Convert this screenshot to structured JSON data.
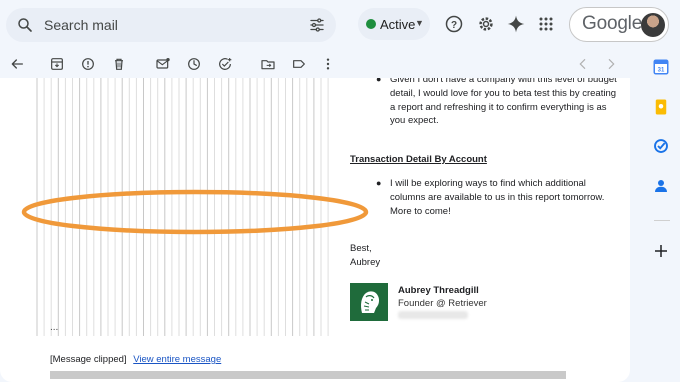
{
  "topbar": {
    "search_placeholder": "Search mail",
    "status_label": "Active",
    "brand_label": "Google"
  },
  "email": {
    "bullet1": "Given I don't have a company with this level of budget detail, I would love for you to beta test this by creating a report and refreshing it to confirm everything is as you expect.",
    "heading": "Transaction Detail By Account",
    "bullet2": "I will be exploring ways to find which additional columns are available to us in this report tomorrow. More to come!",
    "closing": "Best,",
    "sender": "Aubrey",
    "signature_name": "Aubrey Threadgill",
    "signature_role": "Founder @ Retriever",
    "ellipsis": "...",
    "clipped_notice": "[Message clipped]",
    "view_link": "View entire message"
  },
  "colors": {
    "active_dot": "#1e8e3e",
    "annotation_oval": "#f0993a",
    "signature_logo_bg": "#1f6b3b",
    "link": "#1a55c4"
  },
  "icons": [
    "search-icon",
    "tune-icon",
    "help-icon",
    "settings-icon",
    "gemini-icon",
    "apps-icon",
    "back-icon",
    "archive-icon",
    "report-spam-icon",
    "delete-icon",
    "mark-unread-icon",
    "snooze-icon",
    "add-task-icon",
    "move-to-icon",
    "label-icon",
    "more-icon",
    "prev-icon",
    "next-icon",
    "calendar-icon",
    "keep-icon",
    "tasks-icon",
    "contacts-icon",
    "add-icon"
  ]
}
